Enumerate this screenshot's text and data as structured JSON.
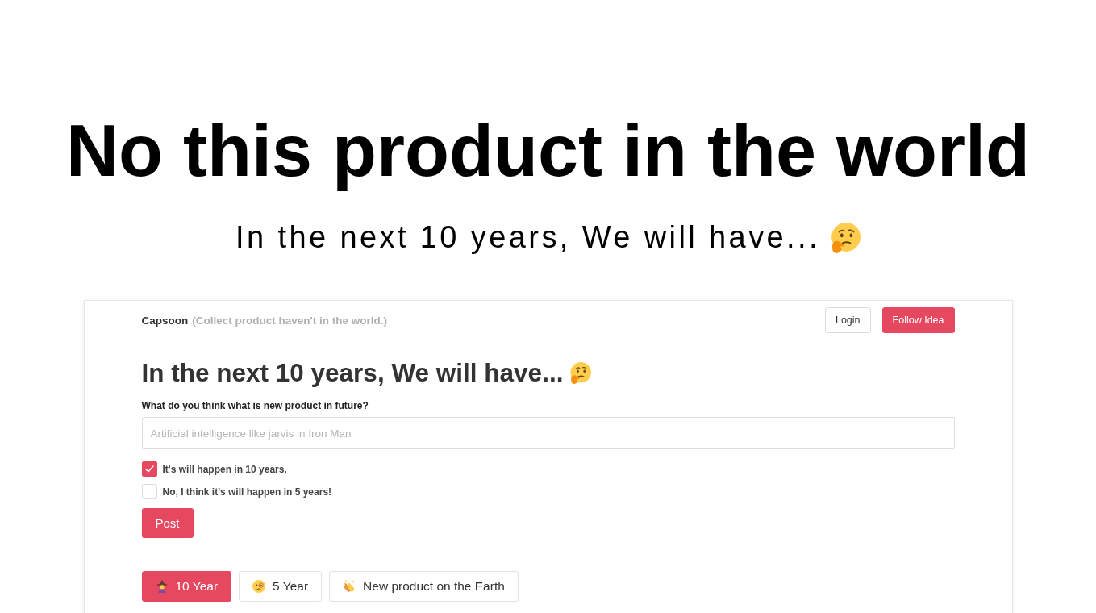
{
  "hero": {
    "title": "No this product in the world",
    "subtitle": "In the next 10 years, We will have..."
  },
  "navbar": {
    "brand": "Capsoon",
    "tagline": "(Collect product haven't in the world.)",
    "buttons": [
      {
        "label": "Login",
        "kind": "outline"
      },
      {
        "label": "Follow Idea",
        "kind": "primary"
      }
    ]
  },
  "form": {
    "heading": "In the next 10 years, We will have...",
    "question": "What do you think what is new product in future?",
    "input": {
      "placeholder": "Artificial intelligence like jarvis in Iron Man"
    },
    "options": [
      {
        "label": "It's will happen in 10 years.",
        "checked": true
      },
      {
        "label": "No, I think it's will happen in 5 years!",
        "checked": false
      }
    ],
    "submit": "Post"
  },
  "tabs": [
    {
      "label": "10 Year",
      "selected": true
    },
    {
      "label": "5 Year",
      "selected": false
    },
    {
      "label": "New product on the Earth",
      "selected": false
    }
  ]
}
